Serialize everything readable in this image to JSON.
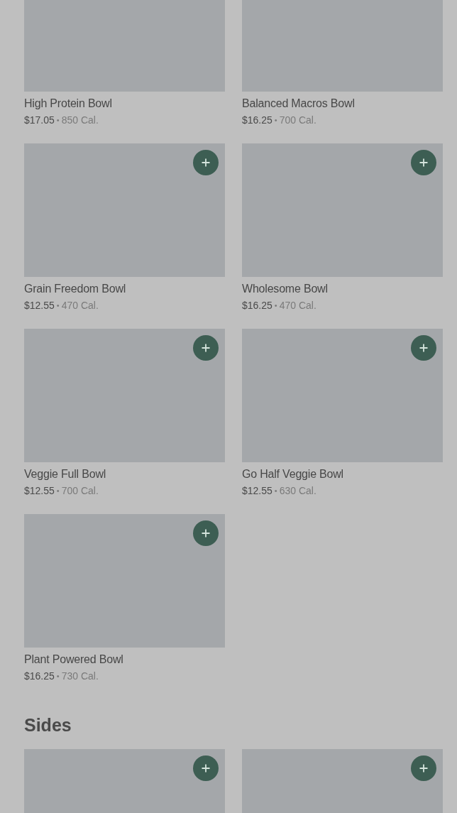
{
  "sections": [
    {
      "items": [
        {
          "name": "High Protein Bowl",
          "price": "$17.05",
          "separator": "•",
          "calories": "850 Cal."
        },
        {
          "name": "Balanced Macros Bowl",
          "price": "$16.25",
          "separator": "•",
          "calories": "700 Cal."
        },
        {
          "name": "Grain Freedom Bowl",
          "price": "$12.55",
          "separator": "•",
          "calories": "470 Cal.",
          "add_button": true
        },
        {
          "name": "Wholesome Bowl",
          "price": "$16.25",
          "separator": "•",
          "calories": "470 Cal.",
          "add_button": true
        },
        {
          "name": "Veggie Full Bowl",
          "price": "$12.55",
          "separator": "•",
          "calories": "700 Cal.",
          "add_button": true
        },
        {
          "name": "Go Half Veggie Bowl",
          "price": "$12.55",
          "separator": "•",
          "calories": "630 Cal.",
          "add_button": true
        },
        {
          "name": "Plant Powered Bowl",
          "price": "$16.25",
          "separator": "•",
          "calories": "730 Cal.",
          "add_button": true
        }
      ]
    },
    {
      "title": "Sides",
      "items": [
        {
          "add_button": true
        },
        {
          "add_button": true
        }
      ]
    }
  ]
}
